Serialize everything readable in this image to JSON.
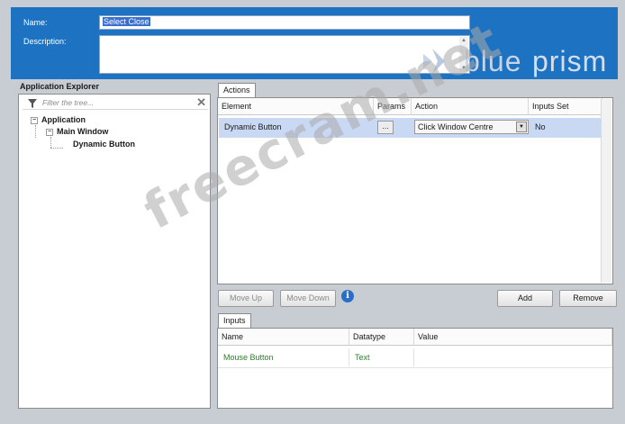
{
  "header": {
    "name_label": "Name:",
    "name_value": "Select Close",
    "description_label": "Description:",
    "description_value": ""
  },
  "logo": {
    "text_bold": "blue",
    "text_light": "prism",
    "icon": "blueprism-logo-icon"
  },
  "app_explorer": {
    "title": "Application Explorer",
    "filter_placeholder": "Filter the tree...",
    "filter_icon": "filter-icon",
    "clear_icon": "close-icon",
    "tree": [
      {
        "label": "Application",
        "expanded": true
      },
      {
        "label": "Main Window",
        "expanded": true
      },
      {
        "label": "Dynamic Button"
      }
    ]
  },
  "actions": {
    "tab_label": "Actions",
    "columns": [
      "Element",
      "Params",
      "Action",
      "Inputs Set"
    ],
    "rows": [
      {
        "element": "Dynamic Button",
        "params": "...",
        "action": "Click Window Centre",
        "inputs_set": "No"
      }
    ]
  },
  "buttons": {
    "move_up": "Move Up",
    "move_down": "Move Down",
    "info_icon": "info-icon",
    "add": "Add",
    "remove": "Remove"
  },
  "inputs": {
    "tab_label": "Inputs",
    "columns": [
      "Name",
      "Datatype",
      "Value"
    ],
    "rows": [
      {
        "name": "Mouse Button",
        "datatype": "Text",
        "value": ""
      }
    ]
  },
  "watermark": "freecram.net",
  "colors": {
    "header_bg": "#1e72c2",
    "selected_row": "#c9d8f3",
    "input_text_green": "#2f7d2f",
    "info_blue": "#2a6fc7"
  }
}
